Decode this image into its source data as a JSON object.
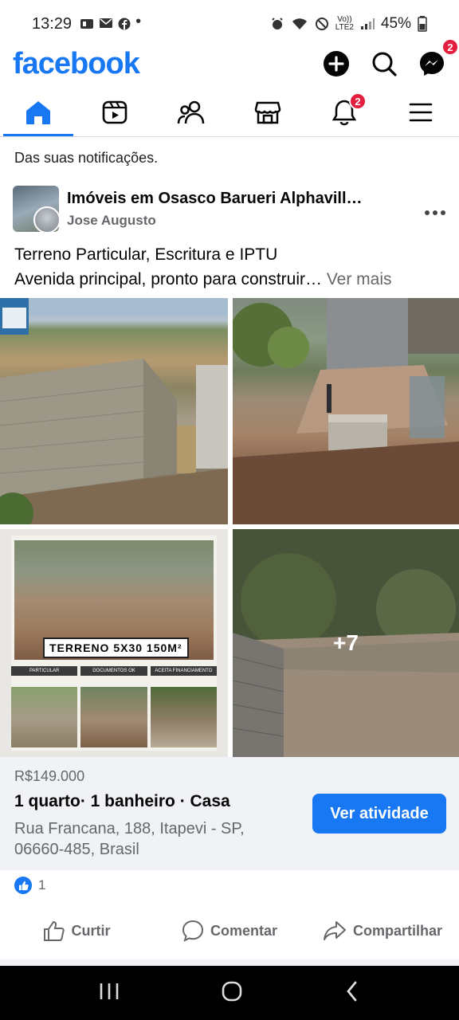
{
  "status": {
    "time": "13:29",
    "left_icons": [
      "app-icon",
      "mail-icon",
      "facebook-icon",
      "dot"
    ],
    "right_text": "45%",
    "network_label": "LTE2"
  },
  "header": {
    "logo": "facebook",
    "messenger_badge": "2",
    "accent": "#1877f2"
  },
  "nav": {
    "items": [
      "home",
      "video",
      "friends",
      "marketplace",
      "notifications",
      "menu"
    ],
    "notifications_badge": "2"
  },
  "notification_label": "Das suas notificações.",
  "post": {
    "group_name": "Imóveis em Osasco Barueri Alphavill…",
    "author": "Jose Augusto",
    "text_line1": "Terreno Particular, Escritura e IPTU",
    "text_line2": "Avenida principal, pronto para construir… ",
    "see_more": "Ver mais",
    "photo3_title": "TERRENO 5X30 150M²",
    "photo3_tags": [
      "PARTICULAR",
      "DOCUMENTOS OK",
      "ACEITA FINANCIAMENTO"
    ],
    "more_count": "+7"
  },
  "listing": {
    "price": "R$149.000",
    "title": "1 quarto· 1 banheiro · Casa",
    "address": "Rua Francana, 188, Itapevi - SP, 06660-485, Brasil",
    "button": "Ver atividade"
  },
  "reactions": {
    "count": "1"
  },
  "actions": {
    "like": "Curtir",
    "comment": "Comentar",
    "share": "Compartilhar"
  }
}
